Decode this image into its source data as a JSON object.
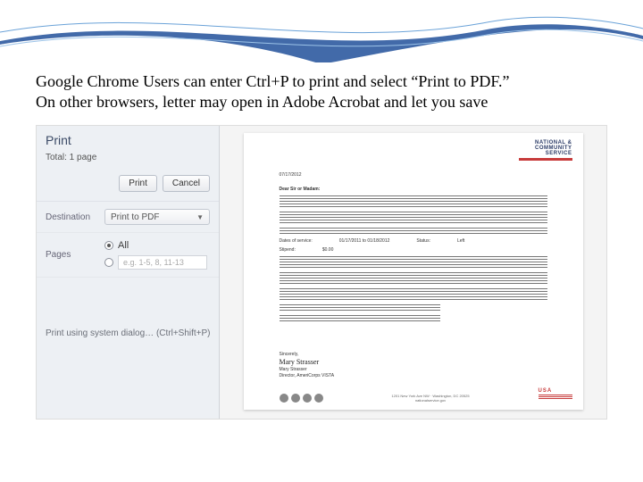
{
  "instruction": {
    "line1": "Google Chrome Users can enter Ctrl+P to print and select “Print to PDF.”",
    "line2": "On other browsers, letter may open in Adobe Acrobat and let you save"
  },
  "print_panel": {
    "title": "Print",
    "total": "Total: 1 page",
    "buttons": {
      "print": "Print",
      "cancel": "Cancel"
    },
    "destination_label": "Destination",
    "destination_value": "Print to PDF",
    "pages_label": "Pages",
    "pages_all": "All",
    "pages_range_placeholder": "e.g. 1-5, 8, 11-13",
    "system_dialog": "Print using system dialog… (Ctrl+Shift+P)"
  },
  "letter": {
    "logo_text": "NATIONAL &\nCOMMUNITY\nSERVICE",
    "date": "07/17/2012",
    "salutation": "Dear Sir or Madam:",
    "dates_label": "Dates of service:",
    "dates_value": "01/17/2011 to 01/18/2012",
    "status_label": "Status:",
    "status_value": "Left",
    "stipend_label": "Stipend:",
    "stipend_value": "$0.00",
    "closing": "Sincerely,",
    "signature": "Mary Strasser",
    "sig_title": "Director, AmeriCorps VISTA",
    "usa_label": "USA"
  }
}
